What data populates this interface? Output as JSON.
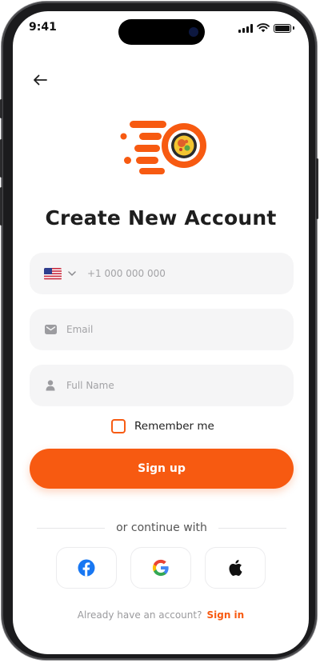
{
  "status_bar": {
    "time": "9:41"
  },
  "header": {
    "back_icon": "arrow-left-icon"
  },
  "brand": {
    "logo_icon": "food-bowl-speed-logo",
    "accent_color": "#F75A11"
  },
  "title": "Create New Account",
  "form": {
    "phone": {
      "country": "US",
      "flag_icon": "us-flag-icon",
      "placeholder": "+1 000 000 000"
    },
    "email": {
      "icon": "mail-icon",
      "placeholder": "Email"
    },
    "full_name": {
      "icon": "user-icon",
      "placeholder": "Full Name"
    },
    "remember_label": "Remember me",
    "remember_checked": false,
    "submit_label": "Sign up"
  },
  "divider_text": "or continue with",
  "social": [
    {
      "provider": "facebook",
      "icon": "facebook-icon"
    },
    {
      "provider": "google",
      "icon": "google-icon"
    },
    {
      "provider": "apple",
      "icon": "apple-icon"
    }
  ],
  "footer": {
    "question": "Already have an account?",
    "link_label": "Sign in"
  }
}
